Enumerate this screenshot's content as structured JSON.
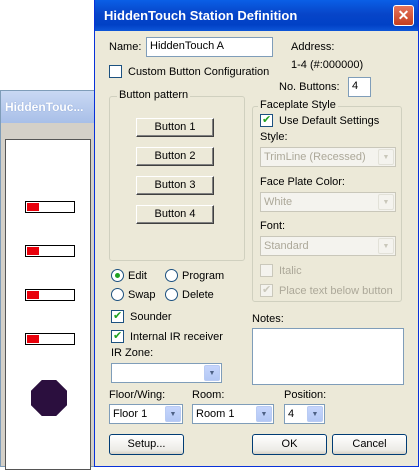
{
  "back_window": {
    "title": "HiddenTouc..."
  },
  "dialog": {
    "title": "HiddenTouch Station Definition",
    "close_glyph": "✕",
    "name_label": "Name:",
    "name_value": "HiddenTouch A",
    "address_label": "Address:",
    "address_value": "1-4 (#:000000)",
    "custom_config_label": "Custom Button Configuration",
    "custom_config_checked": false,
    "num_buttons_label": "No. Buttons:",
    "num_buttons_value": "4",
    "button_pattern": {
      "title": "Button pattern",
      "buttons": [
        "Button 1",
        "Button 2",
        "Button 3",
        "Button 4"
      ]
    },
    "faceplate": {
      "title": "Faceplate Style",
      "use_default_label": "Use Default Settings",
      "use_default_checked": true,
      "style_label": "Style:",
      "style_value": "TrimLine (Recessed)",
      "color_label": "Face Plate Color:",
      "color_value": "White",
      "font_label": "Font:",
      "font_value": "Standard",
      "italic_label": "Italic",
      "italic_checked": false,
      "place_text_label": "Place text below button",
      "place_text_checked": true
    },
    "mode": {
      "edit": "Edit",
      "program": "Program",
      "swap": "Swap",
      "delete": "Delete",
      "selected": "edit"
    },
    "sounder_label": "Sounder",
    "sounder_checked": true,
    "ir_receiver_label": "Internal IR receiver",
    "ir_receiver_checked": true,
    "ir_zone_label": "IR Zone:",
    "ir_zone_value": "",
    "notes_label": "Notes:",
    "floor_label": "Floor/Wing:",
    "floor_value": "Floor 1",
    "room_label": "Room:",
    "room_value": "Room 1",
    "position_label": "Position:",
    "position_value": "4",
    "setup_button": "Setup...",
    "ok_button": "OK",
    "cancel_button": "Cancel"
  },
  "colors": {
    "titlebar": "#0a5fe6",
    "dialog_bg": "#ece9d8",
    "led_red": "#e8000b",
    "ir_sensor": "#2b0f3e",
    "check_green": "#21a121"
  }
}
